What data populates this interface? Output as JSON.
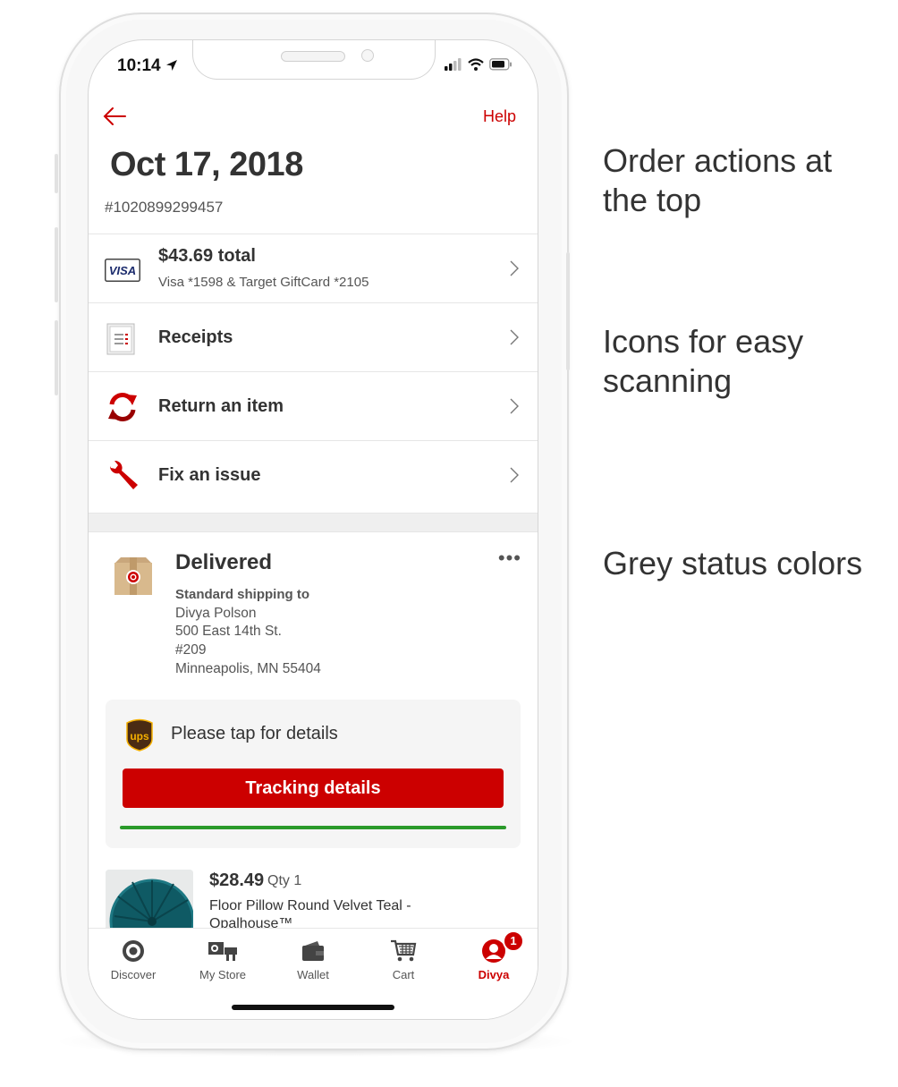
{
  "status_bar": {
    "time": "10:14"
  },
  "header": {
    "help": "Help"
  },
  "order": {
    "date": "Oct 17, 2018",
    "number": "#1020899299457"
  },
  "payment": {
    "card_brand": "VISA",
    "total": "$43.69 total",
    "detail": "Visa *1598 & Target GiftCard *2105"
  },
  "actions": [
    {
      "label": "Receipts",
      "icon": "receipt-icon"
    },
    {
      "label": "Return an item",
      "icon": "return-icon"
    },
    {
      "label": "Fix an issue",
      "icon": "wrench-icon"
    }
  ],
  "delivery": {
    "status": "Delivered",
    "more": "•••",
    "shipping_label": "Standard shipping to",
    "address": [
      "Divya Polson",
      "500 East 14th St.",
      "#209",
      "Minneapolis, MN 55404"
    ]
  },
  "tracking": {
    "message": "Please tap for details",
    "button": "Tracking details",
    "progress": 1.0
  },
  "product": {
    "price": "$28.49",
    "qty": "Qty 1",
    "name": "Floor Pillow Round Velvet Teal - Opalhouse™"
  },
  "tabs": [
    {
      "label": "Discover",
      "icon": "target-bullseye-icon"
    },
    {
      "label": "My Store",
      "icon": "store-icon"
    },
    {
      "label": "Wallet",
      "icon": "wallet-icon"
    },
    {
      "label": "Cart",
      "icon": "cart-icon"
    },
    {
      "label": "Divya",
      "icon": "account-icon",
      "badge": "1",
      "active": true
    }
  ],
  "annotations": [
    "Order actions at the top",
    "Icons for easy scanning",
    "Grey status colors"
  ],
  "colors": {
    "accent": "#cc0000",
    "progress": "#2a9a2a",
    "text": "#333333"
  }
}
